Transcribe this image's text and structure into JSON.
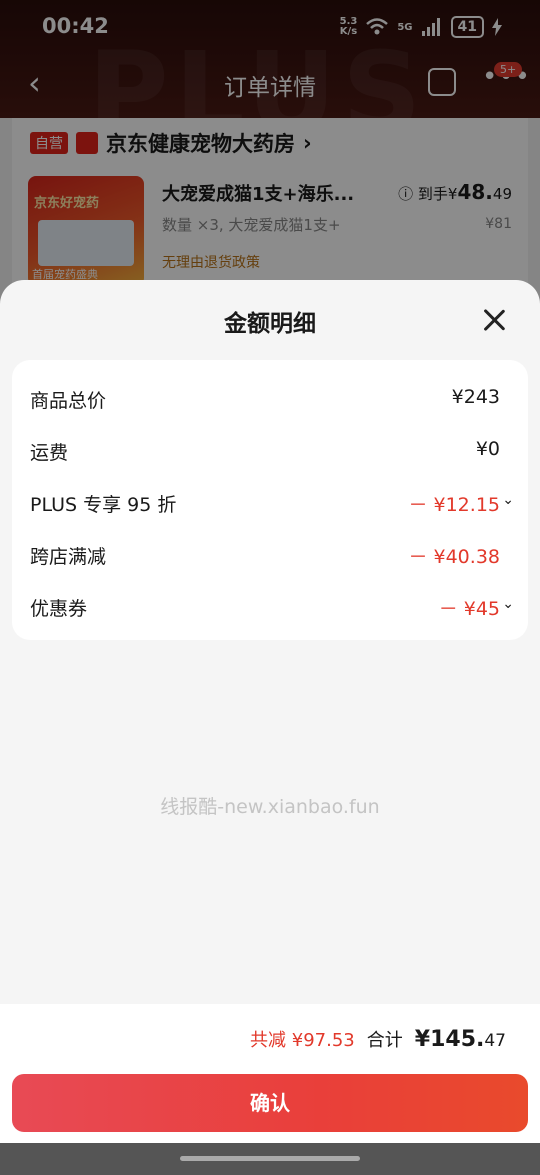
{
  "status": {
    "time": "00:42",
    "net_speed_top": "5.3",
    "net_speed_bottom": "K/s",
    "signal": "5G",
    "battery": "41"
  },
  "nav": {
    "title": "订单详情",
    "back_glyph": "‹",
    "more_glyph": "•••",
    "badge": "5+"
  },
  "watermark_bg": "PLUS",
  "store": {
    "tag": "自营",
    "name": "京东健康宠物大药房",
    "chevron": "›"
  },
  "product": {
    "image_text_top": "京东好宠药",
    "image_text_bottom": "首届宠药盛典",
    "title": "大宠爱成猫1支+海乐...",
    "price_prefix": "到手¥",
    "price_int": "48.",
    "price_dec": "49",
    "qty": "数量 ×3, 大宠爱成猫1支+",
    "orig_price": "¥81",
    "policy": "无理由退货政策"
  },
  "sheet": {
    "title": "金额明细",
    "rows": [
      {
        "label": "商品总价",
        "value": "¥243"
      },
      {
        "label": "运费",
        "value": "¥0"
      },
      {
        "label": "PLUS 专享 95 折",
        "value": "－ ¥12.15"
      },
      {
        "label": "跨店满减",
        "value": "－ ¥40.38"
      },
      {
        "label": "优惠券",
        "value": "－ ¥45"
      }
    ],
    "watermark": "线报酷-new.xianbao.fun"
  },
  "footer": {
    "saved": "共减 ¥97.53",
    "total_label": "合计",
    "total_int": "¥145.",
    "total_dec": "47",
    "confirm_label": "确认"
  },
  "colors": {
    "accent_red": "#e2392b",
    "button_red": "#e93f3a"
  }
}
